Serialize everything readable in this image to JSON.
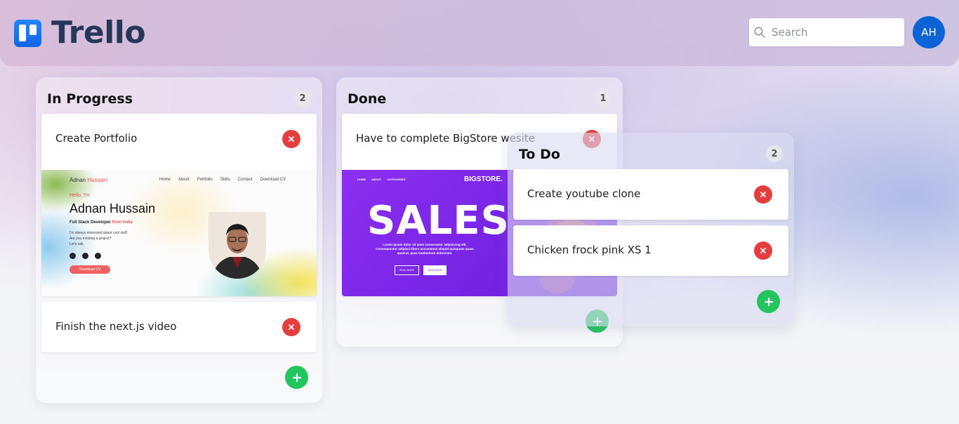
{
  "app": {
    "logo_text": "Trello",
    "search": {
      "placeholder": "Search",
      "value": ""
    },
    "avatar_initials": "AH"
  },
  "columns": [
    {
      "title": "In Progress",
      "count": "2",
      "cards": [
        {
          "title": "Create Portfolio",
          "thumbnail": {
            "brand_first": "Adnan",
            "brand_last": "Hussain",
            "nav": [
              "Home",
              "About",
              "Portfolio",
              "Skills",
              "Contact",
              "Download CV"
            ],
            "greeting": "Hello, I'm",
            "name": "Adnan Hussain",
            "role_prefix": "Full Stack Developer",
            "role_suffix": "from India",
            "desc_lines": [
              "I'm always interested about cool stuff.",
              "Are you minding a project?",
              "Let's talk."
            ],
            "cv_button": "Download CV"
          }
        },
        {
          "title": "Finish the next.js video"
        }
      ]
    },
    {
      "title": "Done",
      "count": "1",
      "cards": [
        {
          "title": "Have to complete BigStore wesite",
          "thumbnail": {
            "nav": [
              "HOME",
              "ABOUT",
              "CATEGORIES"
            ],
            "brand": "BIGSTORE.",
            "headline": "SALES",
            "text": "Lorem ipsum dolor sit amet consectetur adipisicing elit. Consequuntur adipisci libero accusamus aliquid quisquam quam quaerat, quas laudantium doloremm.",
            "button1": "READ MORE",
            "button2": "SHOP NOW"
          }
        }
      ]
    },
    {
      "title": "To Do",
      "count": "2",
      "cards": [
        {
          "title": "Create youtube clone"
        },
        {
          "title": "Chicken frock pink XS 1"
        }
      ]
    }
  ],
  "colors": {
    "delete": "#e53e3e",
    "add": "#22c55e",
    "avatar": "#0c63d6",
    "logo": "#0c66e4"
  }
}
